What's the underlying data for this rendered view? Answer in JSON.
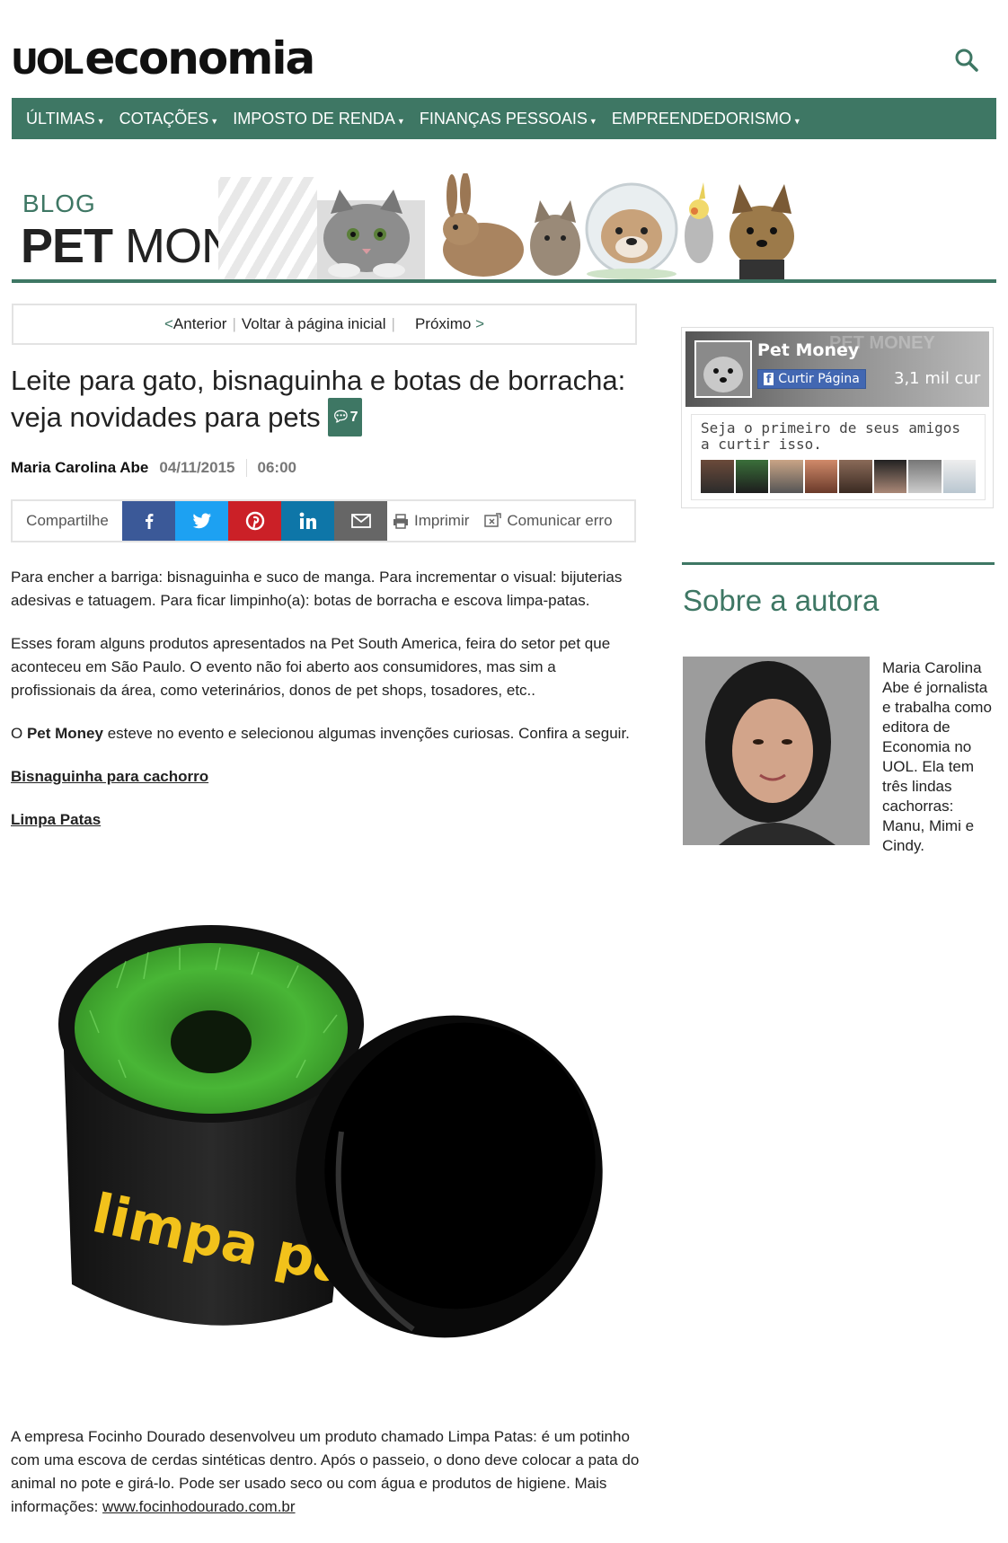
{
  "header": {
    "logo_uol": "UOL",
    "logo_section": "economia",
    "accent": "#3e7764"
  },
  "nav": {
    "items": [
      {
        "label": "ÚLTIMAS"
      },
      {
        "label": "COTAÇÕES"
      },
      {
        "label": "IMPOSTO DE RENDA"
      },
      {
        "label": "FINANÇAS PESSOAIS"
      },
      {
        "label": "EMPREENDEDORISMO"
      }
    ]
  },
  "banner": {
    "blog_word": "BLOG",
    "pet": "PET",
    "money": "MONEY"
  },
  "pager": {
    "prev_symbol": "<",
    "prev": "Anterior",
    "home": "Voltar à página inicial",
    "next": "Próximo",
    "next_symbol": ">"
  },
  "article": {
    "title": "Leite para gato, bisnaguinha e botas de borracha: veja novidades para pets",
    "comment_count": "7",
    "author": "Maria Carolina Abe",
    "date": "04/11/2015",
    "time": "06:00",
    "paragraph_1": "Para encher a barriga: bisnaguinha e suco de manga. Para incrementar o visual: bijuterias adesivas e tatuagem. Para ficar limpinho(a): botas de borracha e escova limpa-patas.",
    "paragraph_2": "Esses foram alguns produtos apresentados na Pet South America, feira do setor pet que aconteceu em São Paulo. O evento não foi aberto aos consumidores, mas sim a profissionais da área, como veterinários, donos de pet shops, tosadores, etc..",
    "paragraph_3_pre": "O ",
    "paragraph_3_bold": "Pet Money",
    "paragraph_3_post": " esteve no evento e selecionou algumas invenções curiosas. Confira a seguir.",
    "link_1": "Bisnaguinha para cachorro",
    "link_2": "Limpa Patas",
    "product_label": "limpa patas",
    "caption_text": "A empresa Focinho Dourado desenvolveu um produto chamado Limpa Patas: é um potinho com uma escova de cerdas sintéticas dentro. Após o passeio, o dono deve colocar a pata do animal no pote e girá-lo. Pode ser usado seco ou com água e produtos de higiene. Mais informações: ",
    "caption_link": "www.focinhodourado.com.br"
  },
  "share": {
    "label": "Compartilhe",
    "print": "Imprimir",
    "report": "Comunicar erro",
    "icons": [
      "facebook-icon",
      "twitter-icon",
      "pinterest-icon",
      "linkedin-icon",
      "email-icon"
    ]
  },
  "facebook_box": {
    "page_name": "Pet Money",
    "like_label": "Curtir Página",
    "like_count": "3,1 mil cur",
    "friends_text": "Seja o primeiro de seus amigos a curtir isso."
  },
  "about": {
    "title": "Sobre a autora",
    "bio": "Maria Carolina Abe é jornalista e trabalha como editora de Economia no UOL. Ela tem três lindas cachorras: Manu, Mimi e Cindy."
  }
}
